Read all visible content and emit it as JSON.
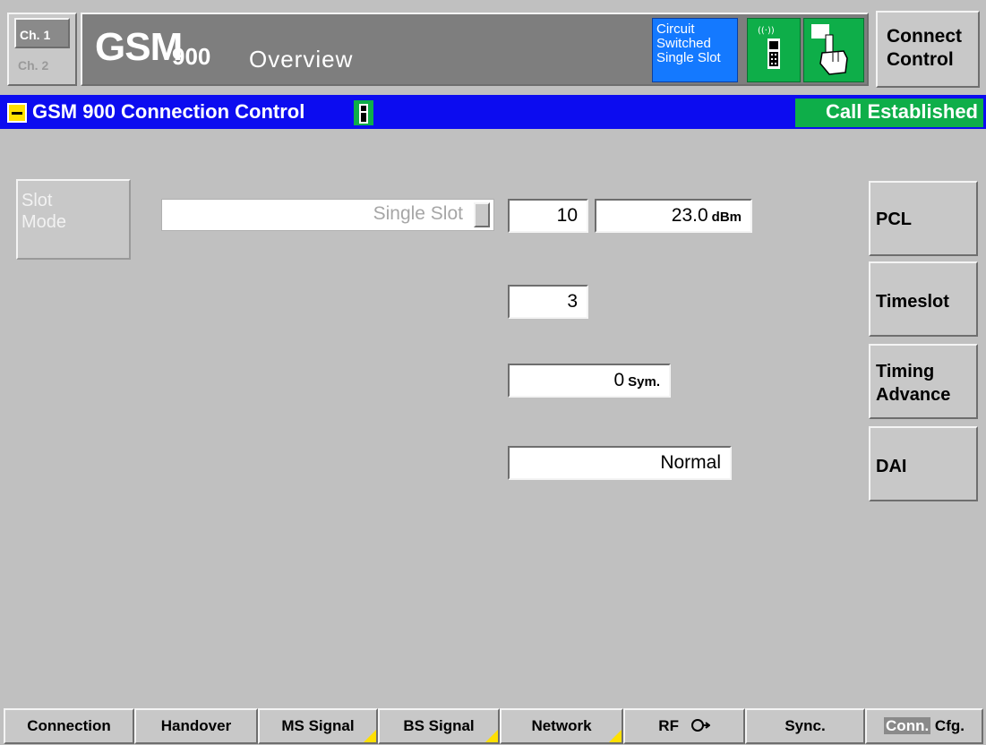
{
  "header": {
    "channel_1": "Ch. 1",
    "channel_2": "Ch. 2",
    "title_main": "GSM",
    "title_band": "900",
    "title_view": "Overview",
    "mode_lines": [
      "Circuit",
      "Switched",
      "Single Slot"
    ],
    "connect_control": [
      "Connect",
      "Control"
    ]
  },
  "status_bar": {
    "panel_title": "GSM 900  Connection Control",
    "call_state": "Call Established"
  },
  "main": {
    "slot_mode_label": [
      "Slot",
      "Mode"
    ],
    "slot_mode_value": "Single Slot",
    "pcl": {
      "value": "10",
      "power": "23.0",
      "power_unit": "dBm"
    },
    "timeslot": {
      "value": "3"
    },
    "timing_advance": {
      "value": "0",
      "unit": "Sym."
    },
    "dai": {
      "value": "Normal"
    }
  },
  "side_buttons": {
    "pcl": "PCL",
    "timeslot": "Timeslot",
    "timing_advance": [
      "Timing",
      "Advance"
    ],
    "dai": "DAI"
  },
  "tabs": {
    "connection": "Connection",
    "handover": "Handover",
    "ms_signal": "MS Signal",
    "bs_signal": "BS Signal",
    "network": "Network",
    "rf": "RF",
    "sync": "Sync.",
    "conn_cfg_conn": "Conn.",
    "conn_cfg_cfg": "Cfg."
  },
  "colors": {
    "status_bar_blue": "#0c0cf0",
    "established_green": "#0eae49",
    "circuit_blue": "#1479ff",
    "softkey_corner_yellow": "#ffe000"
  }
}
